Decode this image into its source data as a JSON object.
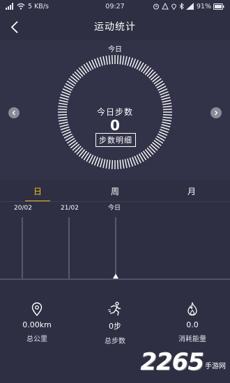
{
  "status_bar": {
    "signal_text": "5 KB/s",
    "time": "09:27",
    "battery": "91%"
  },
  "nav": {
    "title": "运动统计"
  },
  "dial": {
    "top_label": "今日",
    "label": "今日步数",
    "value": "0",
    "detail_button": "步数明细"
  },
  "tabs": [
    {
      "label": "日",
      "active": true
    },
    {
      "label": "周",
      "active": false
    },
    {
      "label": "月",
      "active": false
    }
  ],
  "timeline": {
    "labels": [
      "20/02",
      "21/02",
      "今日"
    ]
  },
  "stats": [
    {
      "icon": "location-pin-icon",
      "value": "0.00km",
      "label": "总公里"
    },
    {
      "icon": "running-person-icon",
      "value": "0步",
      "label": "总步数"
    },
    {
      "icon": "flame-icon",
      "value": "0.0",
      "label": "消耗能量"
    }
  ],
  "watermark": {
    "number": "2265",
    "site": "手游网"
  },
  "colors": {
    "background": "#2f2f44",
    "accent": "#f0c419"
  }
}
